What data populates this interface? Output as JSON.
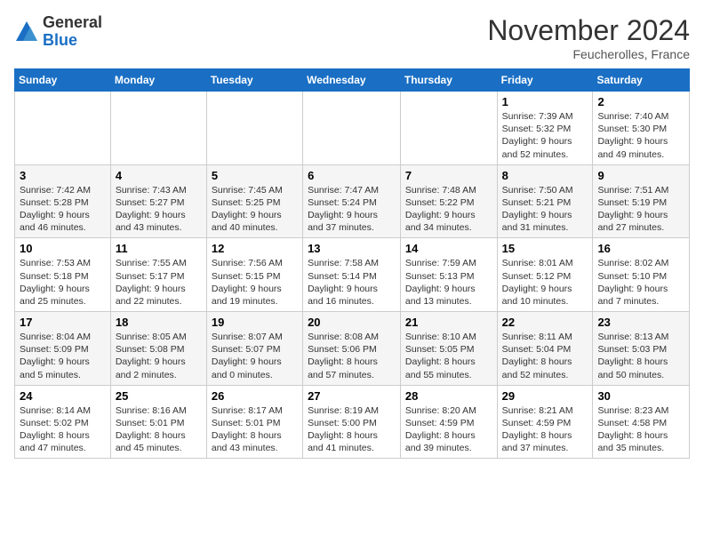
{
  "logo": {
    "general": "General",
    "blue": "Blue"
  },
  "header": {
    "month": "November 2024",
    "location": "Feucherolles, France"
  },
  "days_of_week": [
    "Sunday",
    "Monday",
    "Tuesday",
    "Wednesday",
    "Thursday",
    "Friday",
    "Saturday"
  ],
  "weeks": [
    [
      {
        "day": "",
        "info": ""
      },
      {
        "day": "",
        "info": ""
      },
      {
        "day": "",
        "info": ""
      },
      {
        "day": "",
        "info": ""
      },
      {
        "day": "",
        "info": ""
      },
      {
        "day": "1",
        "info": "Sunrise: 7:39 AM\nSunset: 5:32 PM\nDaylight: 9 hours and 52 minutes."
      },
      {
        "day": "2",
        "info": "Sunrise: 7:40 AM\nSunset: 5:30 PM\nDaylight: 9 hours and 49 minutes."
      }
    ],
    [
      {
        "day": "3",
        "info": "Sunrise: 7:42 AM\nSunset: 5:28 PM\nDaylight: 9 hours and 46 minutes."
      },
      {
        "day": "4",
        "info": "Sunrise: 7:43 AM\nSunset: 5:27 PM\nDaylight: 9 hours and 43 minutes."
      },
      {
        "day": "5",
        "info": "Sunrise: 7:45 AM\nSunset: 5:25 PM\nDaylight: 9 hours and 40 minutes."
      },
      {
        "day": "6",
        "info": "Sunrise: 7:47 AM\nSunset: 5:24 PM\nDaylight: 9 hours and 37 minutes."
      },
      {
        "day": "7",
        "info": "Sunrise: 7:48 AM\nSunset: 5:22 PM\nDaylight: 9 hours and 34 minutes."
      },
      {
        "day": "8",
        "info": "Sunrise: 7:50 AM\nSunset: 5:21 PM\nDaylight: 9 hours and 31 minutes."
      },
      {
        "day": "9",
        "info": "Sunrise: 7:51 AM\nSunset: 5:19 PM\nDaylight: 9 hours and 27 minutes."
      }
    ],
    [
      {
        "day": "10",
        "info": "Sunrise: 7:53 AM\nSunset: 5:18 PM\nDaylight: 9 hours and 25 minutes."
      },
      {
        "day": "11",
        "info": "Sunrise: 7:55 AM\nSunset: 5:17 PM\nDaylight: 9 hours and 22 minutes."
      },
      {
        "day": "12",
        "info": "Sunrise: 7:56 AM\nSunset: 5:15 PM\nDaylight: 9 hours and 19 minutes."
      },
      {
        "day": "13",
        "info": "Sunrise: 7:58 AM\nSunset: 5:14 PM\nDaylight: 9 hours and 16 minutes."
      },
      {
        "day": "14",
        "info": "Sunrise: 7:59 AM\nSunset: 5:13 PM\nDaylight: 9 hours and 13 minutes."
      },
      {
        "day": "15",
        "info": "Sunrise: 8:01 AM\nSunset: 5:12 PM\nDaylight: 9 hours and 10 minutes."
      },
      {
        "day": "16",
        "info": "Sunrise: 8:02 AM\nSunset: 5:10 PM\nDaylight: 9 hours and 7 minutes."
      }
    ],
    [
      {
        "day": "17",
        "info": "Sunrise: 8:04 AM\nSunset: 5:09 PM\nDaylight: 9 hours and 5 minutes."
      },
      {
        "day": "18",
        "info": "Sunrise: 8:05 AM\nSunset: 5:08 PM\nDaylight: 9 hours and 2 minutes."
      },
      {
        "day": "19",
        "info": "Sunrise: 8:07 AM\nSunset: 5:07 PM\nDaylight: 9 hours and 0 minutes."
      },
      {
        "day": "20",
        "info": "Sunrise: 8:08 AM\nSunset: 5:06 PM\nDaylight: 8 hours and 57 minutes."
      },
      {
        "day": "21",
        "info": "Sunrise: 8:10 AM\nSunset: 5:05 PM\nDaylight: 8 hours and 55 minutes."
      },
      {
        "day": "22",
        "info": "Sunrise: 8:11 AM\nSunset: 5:04 PM\nDaylight: 8 hours and 52 minutes."
      },
      {
        "day": "23",
        "info": "Sunrise: 8:13 AM\nSunset: 5:03 PM\nDaylight: 8 hours and 50 minutes."
      }
    ],
    [
      {
        "day": "24",
        "info": "Sunrise: 8:14 AM\nSunset: 5:02 PM\nDaylight: 8 hours and 47 minutes."
      },
      {
        "day": "25",
        "info": "Sunrise: 8:16 AM\nSunset: 5:01 PM\nDaylight: 8 hours and 45 minutes."
      },
      {
        "day": "26",
        "info": "Sunrise: 8:17 AM\nSunset: 5:01 PM\nDaylight: 8 hours and 43 minutes."
      },
      {
        "day": "27",
        "info": "Sunrise: 8:19 AM\nSunset: 5:00 PM\nDaylight: 8 hours and 41 minutes."
      },
      {
        "day": "28",
        "info": "Sunrise: 8:20 AM\nSunset: 4:59 PM\nDaylight: 8 hours and 39 minutes."
      },
      {
        "day": "29",
        "info": "Sunrise: 8:21 AM\nSunset: 4:59 PM\nDaylight: 8 hours and 37 minutes."
      },
      {
        "day": "30",
        "info": "Sunrise: 8:23 AM\nSunset: 4:58 PM\nDaylight: 8 hours and 35 minutes."
      }
    ]
  ]
}
